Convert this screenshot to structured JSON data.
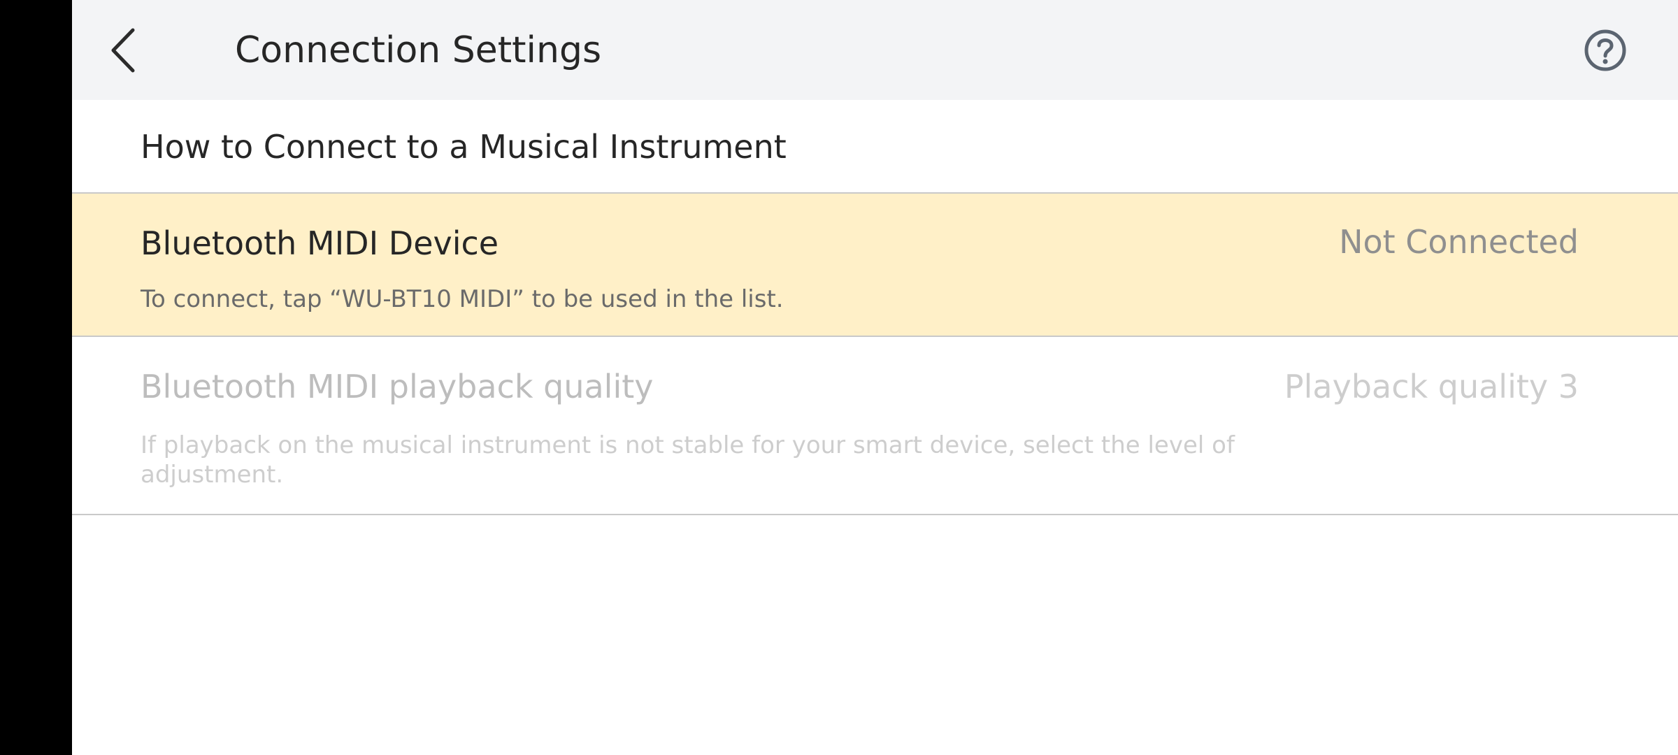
{
  "header": {
    "title": "Connection Settings",
    "back_icon": "chevron-left-icon",
    "help_icon": "help-circle-icon"
  },
  "how_to_connect": {
    "label": "How to Connect to a Musical Instrument"
  },
  "bluetooth_midi_device": {
    "title": "Bluetooth MIDI Device",
    "status": "Not Connected",
    "description": "To connect, tap “WU-BT10 MIDI” to be used in the list.",
    "highlight_color": "#fff0c8"
  },
  "playback_quality": {
    "title": "Bluetooth MIDI playback quality",
    "value": "Playback quality 3",
    "description": "If playback on the musical instrument is not stable for your smart device, select the level of adjustment.",
    "enabled": false
  }
}
